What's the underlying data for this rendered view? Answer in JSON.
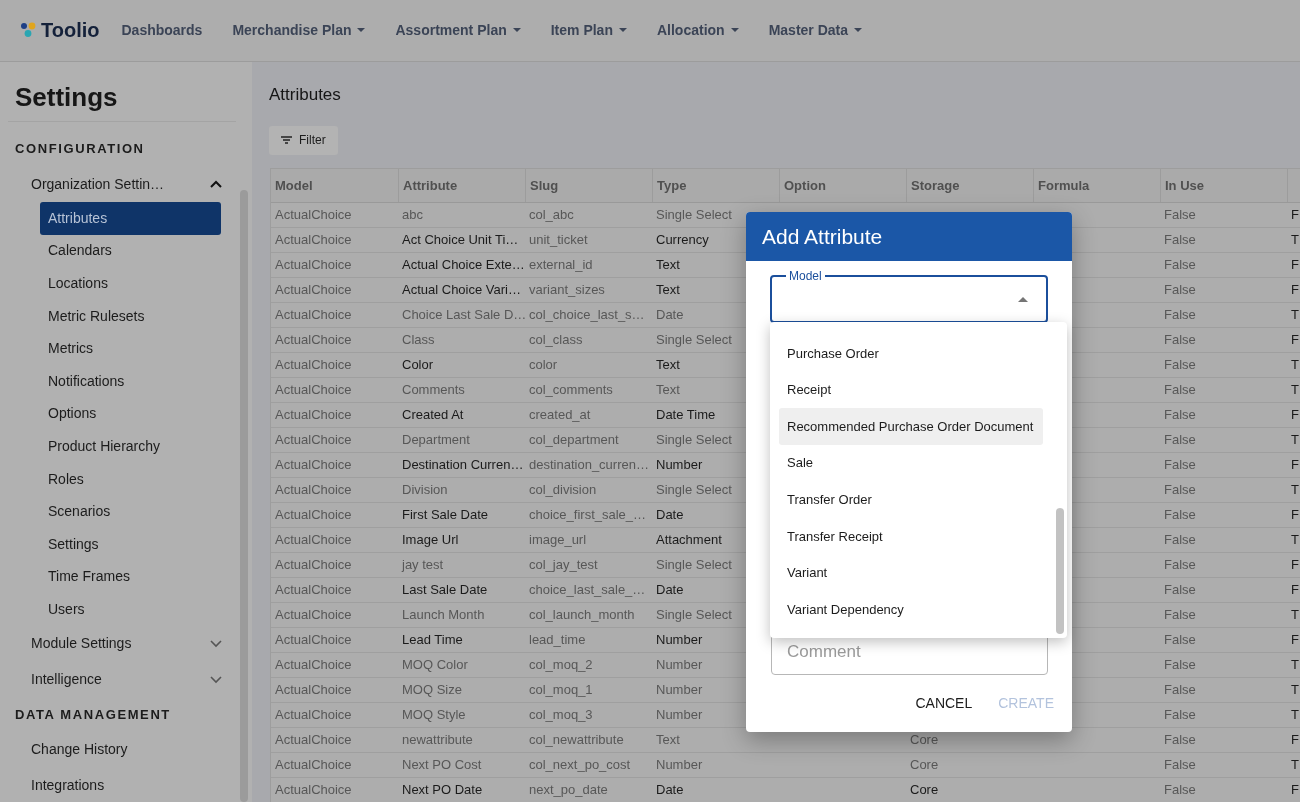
{
  "navbar": {
    "brand": "Toolio",
    "items": [
      {
        "label": "Dashboards",
        "dropdown": false
      },
      {
        "label": "Merchandise Plan",
        "dropdown": true
      },
      {
        "label": "Assortment Plan",
        "dropdown": true
      },
      {
        "label": "Item Plan",
        "dropdown": true
      },
      {
        "label": "Allocation",
        "dropdown": true
      },
      {
        "label": "Master Data",
        "dropdown": true
      }
    ]
  },
  "sidebar": {
    "title": "Settings",
    "sections": [
      {
        "heading": "CONFIGURATION",
        "groups": [
          {
            "kind": "group",
            "label": "Organization Settin…",
            "expanded": true,
            "children": [
              {
                "label": "Attributes",
                "selected": true
              },
              {
                "label": "Calendars",
                "selected": false
              },
              {
                "label": "Locations",
                "selected": false
              },
              {
                "label": "Metric Rulesets",
                "selected": false
              },
              {
                "label": "Metrics",
                "selected": false
              },
              {
                "label": "Notifications",
                "selected": false
              },
              {
                "label": "Options",
                "selected": false
              },
              {
                "label": "Product Hierarchy",
                "selected": false
              },
              {
                "label": "Roles",
                "selected": false
              },
              {
                "label": "Scenarios",
                "selected": false
              },
              {
                "label": "Settings",
                "selected": false
              },
              {
                "label": "Time Frames",
                "selected": false
              },
              {
                "label": "Users",
                "selected": false
              }
            ]
          },
          {
            "kind": "group",
            "label": "Module Settings",
            "expanded": false
          },
          {
            "kind": "group",
            "label": "Intelligence",
            "expanded": false
          }
        ]
      },
      {
        "heading": "DATA MANAGEMENT",
        "groups": [
          {
            "kind": "link",
            "label": "Change History"
          },
          {
            "kind": "link",
            "label": "Integrations"
          }
        ]
      }
    ]
  },
  "page": {
    "title": "Attributes",
    "filter_button": "Filter"
  },
  "table": {
    "columns": [
      "Model",
      "Attribute",
      "Slug",
      "Type",
      "Option",
      "Storage",
      "Formula",
      "In Use"
    ],
    "rows": [
      {
        "model": "ActualChoice",
        "attribute": "abc",
        "slug": "col_abc",
        "type": "Single Select",
        "in_use": "False",
        "column_9": "F",
        "emphasized": false
      },
      {
        "model": "ActualChoice",
        "attribute": "Act Choice Unit Ti…",
        "slug": "unit_ticket",
        "type": "Currency",
        "in_use": "False",
        "column_9": "T",
        "emphasized": true
      },
      {
        "model": "ActualChoice",
        "attribute": "Actual Choice Exte…",
        "slug": "external_id",
        "type": "Text",
        "in_use": "False",
        "column_9": "F",
        "emphasized": true
      },
      {
        "model": "ActualChoice",
        "attribute": "Actual Choice Vari…",
        "slug": "variant_sizes",
        "type": "Text",
        "in_use": "False",
        "column_9": "F",
        "emphasized": true
      },
      {
        "model": "ActualChoice",
        "attribute": "Choice Last Sale D…",
        "slug": "col_choice_last_s…",
        "type": "Date",
        "in_use": "False",
        "column_9": "T",
        "emphasized": false
      },
      {
        "model": "ActualChoice",
        "attribute": "Class",
        "slug": "col_class",
        "type": "Single Select",
        "in_use": "False",
        "column_9": "F",
        "emphasized": false
      },
      {
        "model": "ActualChoice",
        "attribute": "Color",
        "slug": "color",
        "type": "Text",
        "in_use": "False",
        "column_9": "T",
        "emphasized": true
      },
      {
        "model": "ActualChoice",
        "attribute": "Comments",
        "slug": "col_comments",
        "type": "Text",
        "in_use": "False",
        "column_9": "T",
        "emphasized": false
      },
      {
        "model": "ActualChoice",
        "attribute": "Created At",
        "slug": "created_at",
        "type": "Date Time",
        "in_use": "False",
        "column_9": "F",
        "emphasized": true
      },
      {
        "model": "ActualChoice",
        "attribute": "Department",
        "slug": "col_department",
        "type": "Single Select",
        "in_use": "False",
        "column_9": "T",
        "emphasized": false
      },
      {
        "model": "ActualChoice",
        "attribute": "Destination Curren…",
        "slug": "destination_curren…",
        "type": "Number",
        "in_use": "False",
        "column_9": "F",
        "emphasized": true
      },
      {
        "model": "ActualChoice",
        "attribute": "Division",
        "slug": "col_division",
        "type": "Single Select",
        "in_use": "False",
        "column_9": "T",
        "emphasized": false
      },
      {
        "model": "ActualChoice",
        "attribute": "First Sale Date",
        "slug": "choice_first_sale_…",
        "type": "Date",
        "in_use": "False",
        "column_9": "F",
        "emphasized": true
      },
      {
        "model": "ActualChoice",
        "attribute": "Image Url",
        "slug": "image_url",
        "type": "Attachment",
        "in_use": "False",
        "column_9": "T",
        "emphasized": true
      },
      {
        "model": "ActualChoice",
        "attribute": "jay test",
        "slug": "col_jay_test",
        "type": "Single Select",
        "in_use": "False",
        "column_9": "F",
        "emphasized": false
      },
      {
        "model": "ActualChoice",
        "attribute": "Last Sale Date",
        "slug": "choice_last_sale_…",
        "type": "Date",
        "in_use": "False",
        "column_9": "F",
        "emphasized": true
      },
      {
        "model": "ActualChoice",
        "attribute": "Launch Month",
        "slug": "col_launch_month",
        "type": "Single Select",
        "in_use": "False",
        "column_9": "T",
        "emphasized": false
      },
      {
        "model": "ActualChoice",
        "attribute": "Lead Time",
        "slug": "lead_time",
        "type": "Number",
        "in_use": "False",
        "column_9": "F",
        "emphasized": true
      },
      {
        "model": "ActualChoice",
        "attribute": "MOQ Color",
        "slug": "col_moq_2",
        "type": "Number",
        "in_use": "False",
        "column_9": "T",
        "emphasized": false
      },
      {
        "model": "ActualChoice",
        "attribute": "MOQ Size",
        "slug": "col_moq_1",
        "type": "Number",
        "in_use": "False",
        "column_9": "T",
        "emphasized": false
      },
      {
        "model": "ActualChoice",
        "attribute": "MOQ Style",
        "slug": "col_moq_3",
        "type": "Number",
        "in_use": "False",
        "column_9": "T",
        "emphasized": false
      },
      {
        "model": "ActualChoice",
        "attribute": "newattribute",
        "slug": "col_newattribute",
        "type": "Text",
        "storage": "Core",
        "in_use": "False",
        "column_9": "F",
        "emphasized": false
      },
      {
        "model": "ActualChoice",
        "attribute": "Next PO Cost",
        "slug": "col_next_po_cost",
        "type": "Number",
        "storage": "Core",
        "in_use": "False",
        "column_9": "T",
        "emphasized": false
      },
      {
        "model": "ActualChoice",
        "attribute": "Next PO Date",
        "slug": "next_po_date",
        "type": "Date",
        "storage": "Core",
        "in_use": "False",
        "column_9": "F",
        "emphasized": true
      }
    ]
  },
  "dialog": {
    "title": "Add Attribute",
    "model_field": {
      "label": "Model",
      "open": true
    },
    "options": [
      {
        "label": "Purchase Order",
        "highlighted": false
      },
      {
        "label": "Receipt",
        "highlighted": false
      },
      {
        "label": "Recommended Purchase Order Document",
        "highlighted": true
      },
      {
        "label": "Sale",
        "highlighted": false
      },
      {
        "label": "Transfer Order",
        "highlighted": false
      },
      {
        "label": "Transfer Receipt",
        "highlighted": false
      },
      {
        "label": "Variant",
        "highlighted": false
      },
      {
        "label": "Variant Dependency",
        "highlighted": false
      }
    ],
    "comment_field": {
      "placeholder": "Comment"
    },
    "buttons": [
      {
        "label": "CANCEL",
        "disabled": false
      },
      {
        "label": "CREATE",
        "disabled": true
      }
    ]
  }
}
